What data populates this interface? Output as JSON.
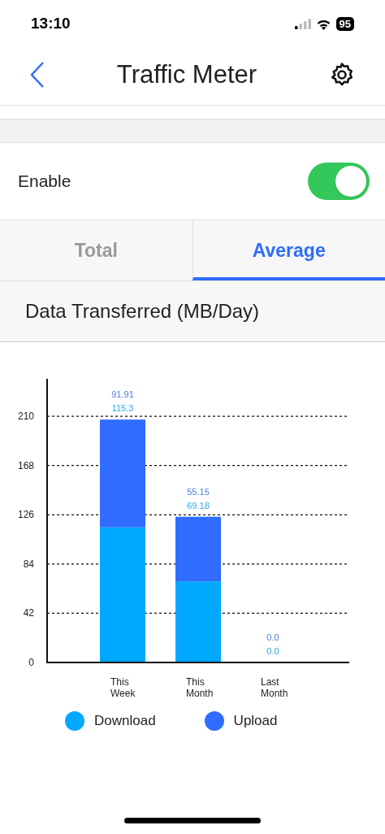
{
  "status_bar": {
    "time": "13:10",
    "battery": "95"
  },
  "nav": {
    "title": "Traffic Meter"
  },
  "enable": {
    "label": "Enable",
    "on": true
  },
  "tabs": [
    {
      "label": "Total",
      "selected": false
    },
    {
      "label": "Average",
      "selected": true
    }
  ],
  "section": {
    "title": "Data Transferred (MB/Day)"
  },
  "chart_data": {
    "type": "bar",
    "stacked": true,
    "categories": [
      "This Week",
      "This Month",
      "Last Month"
    ],
    "series": [
      {
        "name": "Download",
        "color": "#00a8ff",
        "values": [
          115.3,
          69.18,
          0.0
        ]
      },
      {
        "name": "Upload",
        "color": "#2f6cff",
        "values": [
          91.91,
          55.15,
          0.0
        ]
      }
    ],
    "annotations": [
      "91.91",
      "115.3",
      "55.15",
      "69.18",
      "0.0",
      "0.0"
    ],
    "ylim": [
      0,
      242
    ],
    "yticks": [
      0,
      42,
      84,
      126,
      168,
      210
    ],
    "grid": true
  }
}
